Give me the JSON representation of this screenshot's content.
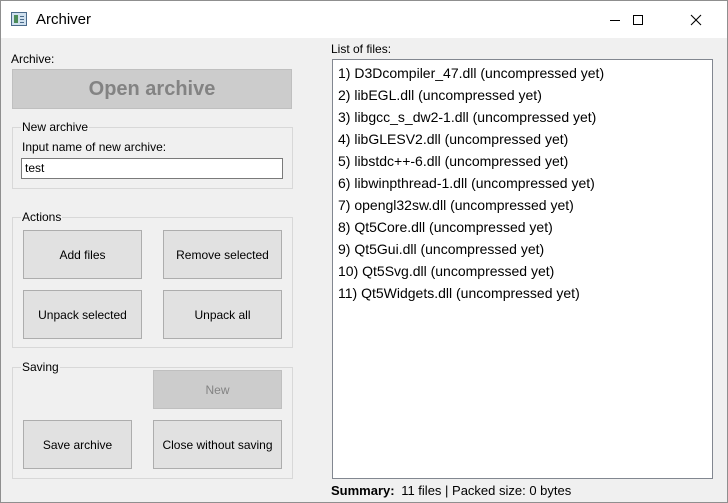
{
  "window": {
    "title": "Archiver"
  },
  "archive": {
    "label": "Archive:",
    "open_button": "Open archive"
  },
  "new_archive": {
    "group_label": "New archive",
    "input_label": "Input name of new archive:",
    "input_value": "test"
  },
  "actions": {
    "group_label": "Actions",
    "add_files": "Add files",
    "remove_selected": "Remove selected",
    "unpack_selected": "Unpack selected",
    "unpack_all": "Unpack all"
  },
  "saving": {
    "group_label": "Saving",
    "new": "New",
    "save_archive": "Save archive",
    "close_without_saving": "Close without saving"
  },
  "files": {
    "label": "List of files:",
    "items": [
      "1) D3Dcompiler_47.dll (uncompressed yet)",
      "2) libEGL.dll (uncompressed yet)",
      "3) libgcc_s_dw2-1.dll (uncompressed yet)",
      "4) libGLESV2.dll (uncompressed yet)",
      "5) libstdc++-6.dll (uncompressed yet)",
      "6) libwinpthread-1.dll (uncompressed yet)",
      "7) opengl32sw.dll (uncompressed yet)",
      "8) Qt5Core.dll (uncompressed yet)",
      "9) Qt5Gui.dll (uncompressed yet)",
      "10) Qt5Svg.dll (uncompressed yet)",
      "11) Qt5Widgets.dll (uncompressed yet)"
    ]
  },
  "summary": {
    "label": "Summary:",
    "text": "11 files | Packed size: 0 bytes"
  }
}
